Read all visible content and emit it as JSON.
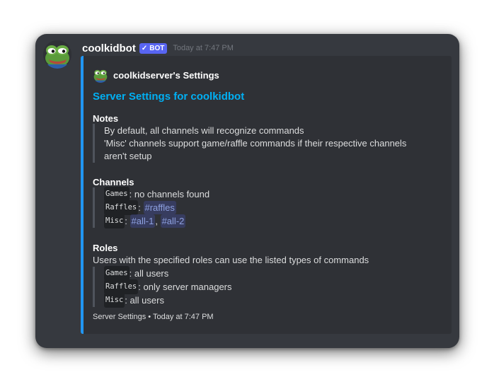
{
  "message": {
    "username": "coolkidbot",
    "badge": "BOT",
    "badge_check": "✓",
    "timestamp": "Today at 7:47 PM",
    "avatar_icon": "pepe-frog-avatar"
  },
  "embed": {
    "accent_color": "#2196f3",
    "author": "coolkidserver's Settings",
    "title": "Server Settings for coolkidbot",
    "notes": {
      "name": "Notes",
      "lines": [
        "By default, all channels will recognize commands",
        "'Misc' channels support game/raffle commands if their respective channels",
        "aren't setup"
      ]
    },
    "channels": {
      "name": "Channels",
      "games_label": "Games",
      "games_value": "no channels found",
      "raffles_label": "Raffles",
      "raffles_channel": "#raffles",
      "misc_label": "Misc",
      "misc_channel_1": "#all-1",
      "misc_channel_2": "#all-2",
      "separator": ","
    },
    "roles": {
      "name": "Roles",
      "description": "Users with the specified roles can use the listed types of commands",
      "games_label": "Games",
      "games_value": "all users",
      "raffles_label": "Raffles",
      "raffles_value": "only server managers",
      "misc_label": "Misc",
      "misc_value": "all users"
    },
    "footer": "Server Settings • Today at 7:47 PM"
  }
}
